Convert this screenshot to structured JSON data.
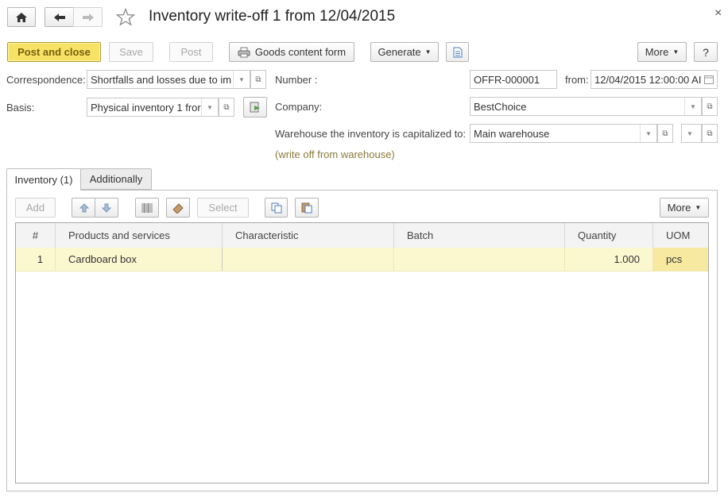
{
  "window": {
    "title": "Inventory write-off 1 from 12/04/2015",
    "close_icon": "×"
  },
  "toolbar": {
    "post_and_close": "Post and close",
    "save": "Save",
    "post": "Post",
    "goods_content_form": "Goods content form",
    "generate": "Generate",
    "more": "More",
    "help": "?"
  },
  "form": {
    "correspondence_label": "Correspondence:",
    "correspondence_value": "Shortfalls and losses due to im",
    "basis_label": "Basis:",
    "basis_value": "Physical inventory 1 fror",
    "number_label": "Number :",
    "number_value": "OFFR-000001",
    "from_label": "from:",
    "from_value": "12/04/2015 12:00:00 AI",
    "company_label": "Company:",
    "company_value": "BestChoice",
    "warehouse_label": "Warehouse the inventory is capitalized to:",
    "warehouse_value": "Main warehouse",
    "write_off_note": "(write off from warehouse)"
  },
  "tabs": [
    {
      "label": "Inventory (1)"
    },
    {
      "label": "Additionally"
    }
  ],
  "table_toolbar": {
    "add": "Add",
    "select": "Select",
    "more": "More"
  },
  "table": {
    "columns": [
      "#",
      "Products and services",
      "Characteristic",
      "Batch",
      "Quantity",
      "UOM"
    ],
    "rows": [
      [
        "1",
        "Cardboard box",
        "",
        "",
        "1.000",
        "pcs"
      ]
    ]
  },
  "colors": {
    "primary_button": "#f6e265",
    "selected_row": "#fbf8d0",
    "note_text": "#8a7a3a"
  }
}
